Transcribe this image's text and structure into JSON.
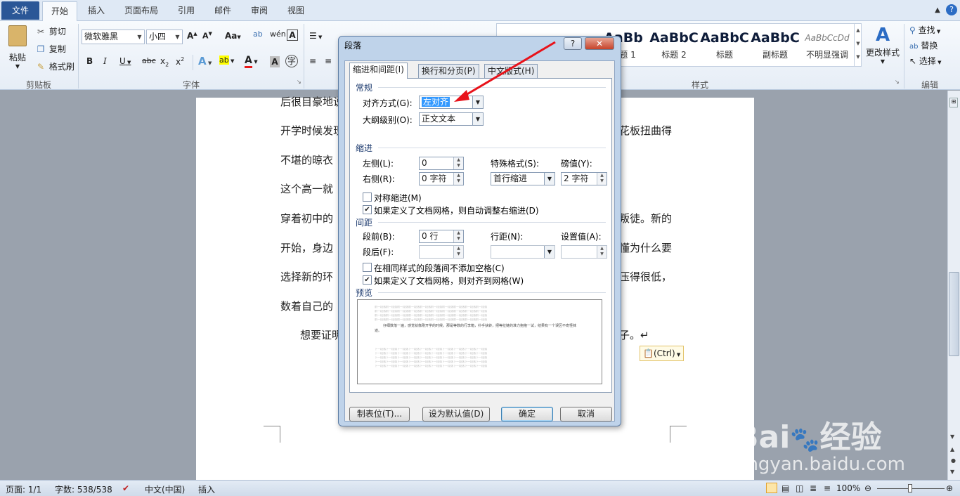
{
  "tabs": [
    "文件",
    "开始",
    "插入",
    "页面布局",
    "引用",
    "邮件",
    "审阅",
    "视图"
  ],
  "ribbon": {
    "clipboard": {
      "paste": "粘贴",
      "cut": "剪切",
      "copy": "复制",
      "format_painter": "格式刷",
      "group": "剪贴板"
    },
    "font": {
      "name": "微软雅黑",
      "size": "小四",
      "group": "字体",
      "aa_label": "Aa"
    },
    "styles": {
      "items": [
        {
          "sample": "AaBb",
          "name": "标题 1"
        },
        {
          "sample": "AaBbC",
          "name": "标题 2"
        },
        {
          "sample": "AaBbC",
          "name": "标题"
        },
        {
          "sample": "AaBbC",
          "name": "副标题"
        },
        {
          "sample": "AaBbCcDd",
          "name": "不明显强调"
        }
      ],
      "change_styles": "更改样式",
      "group": "样式"
    },
    "editing": {
      "find": "查找",
      "replace": "替换",
      "select": "选择",
      "group": "编辑"
    }
  },
  "document": {
    "lines": [
      "后很目豪地说",
      "开学时候发现",
      "不堪的晾衣",
      "这个高一就",
      "穿着初中的",
      "开始，身边",
      "选择新的环",
      "数着自己的",
      "想要证明"
    ],
    "right_fragments": [
      "花板扭曲得",
      "叛徒。新的",
      "懂为什么要",
      "压得很低，",
      "子。↵"
    ],
    "paste_tag": "(Ctrl)"
  },
  "status": {
    "page": "页面: 1/1",
    "words": "字数: 538/538",
    "lang": "中文(中国)",
    "mode": "插入",
    "zoom": "100%"
  },
  "dialog": {
    "title": "段落",
    "help": "?",
    "tabs": [
      "缩进和间距(I)",
      "换行和分页(P)",
      "中文版式(H)"
    ],
    "general": {
      "section": "常规",
      "align_label": "对齐方式(G):",
      "align_value": "左对齐",
      "outline_label": "大纲级别(O):",
      "outline_value": "正文文本"
    },
    "indent": {
      "section": "缩进",
      "left_label": "左侧(L):",
      "left_value": "0",
      "right_label": "右侧(R):",
      "right_value": "0 字符",
      "special_label": "特殊格式(S):",
      "special_value": "首行缩进",
      "by_label": "磅值(Y):",
      "by_value": "2 字符",
      "mirror_label": "对称缩进(M)",
      "mirror_checked": false,
      "auto_label": "如果定义了文档网格，则自动调整右缩进(D)",
      "auto_checked": true
    },
    "spacing": {
      "section": "间距",
      "before_label": "段前(B):",
      "before_value": "0 行",
      "after_label": "段后(F):",
      "after_value": "",
      "line_label": "行距(N):",
      "line_value": "",
      "at_label": "设置值(A):",
      "at_value": "",
      "nosame_label": "在相同样式的段落间不添加空格(C)",
      "nosame_checked": false,
      "grid_label": "如果定义了文档网格，则对齐到网格(W)",
      "grid_checked": true
    },
    "preview": {
      "section": "预览",
      "prev_text": "前一段落前一段落前一段落前一段落前一段落前一段落前一段落前一段落前一段落前一段落",
      "sample_text": "仔细数落一遍，感觉就像刚开学的时候，那是等数的行李箱，扑手扶转，把等拉链的准力抱抱一试，结果有一个误区不奇怪抹迹。",
      "next_text": "下一段落下一段落下一段落下一段落下一段落下一段落下一段落下一段落下一段落下一段落"
    },
    "buttons": {
      "tabs": "制表位(T)...",
      "default": "设为默认值(D)",
      "ok": "确定",
      "cancel": "取消"
    }
  },
  "annotation_color": "#e8121a",
  "watermark": {
    "brand": "Bai",
    "brand2": "经验",
    "url": "jingyan.baidu.com"
  }
}
